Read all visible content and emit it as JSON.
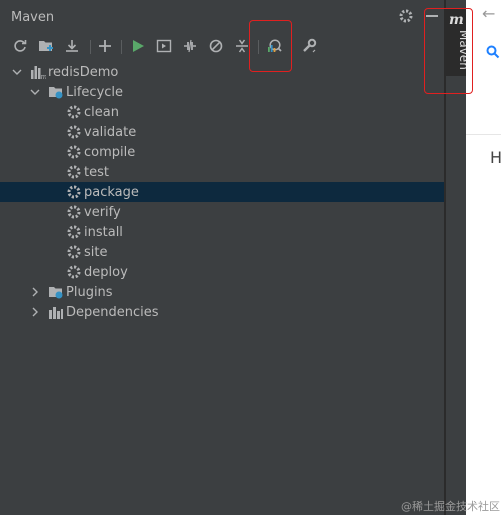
{
  "panel": {
    "title": "Maven"
  },
  "toolbar": [
    {
      "name": "reload-icon"
    },
    {
      "name": "add-folder-icon"
    },
    {
      "name": "download-icon"
    },
    {
      "name": "add-icon"
    },
    {
      "name": "run-icon"
    },
    {
      "name": "run-config-icon"
    },
    {
      "name": "toggle-offline-icon"
    },
    {
      "name": "skip-tests-icon"
    },
    {
      "name": "collapse-icon"
    },
    {
      "name": "analyze-dependencies-icon"
    },
    {
      "name": "build-tool-settings-icon"
    }
  ],
  "tree": {
    "project": "redisDemo",
    "lifecycle": "Lifecycle",
    "goals": [
      "clean",
      "validate",
      "compile",
      "test",
      "package",
      "verify",
      "install",
      "site",
      "deploy"
    ],
    "selected_goal": "package",
    "plugins": "Plugins",
    "dependencies": "Dependencies"
  },
  "side_tab": {
    "letter": "m",
    "label": "Maven"
  },
  "editor": {
    "header_char": "H"
  },
  "watermark": "@稀土掘金技术社区",
  "colors": {
    "panel_bg": "#3c3f41",
    "selected_row": "#0d293e",
    "highlight": "#e02020",
    "run_green": "#59a869"
  }
}
